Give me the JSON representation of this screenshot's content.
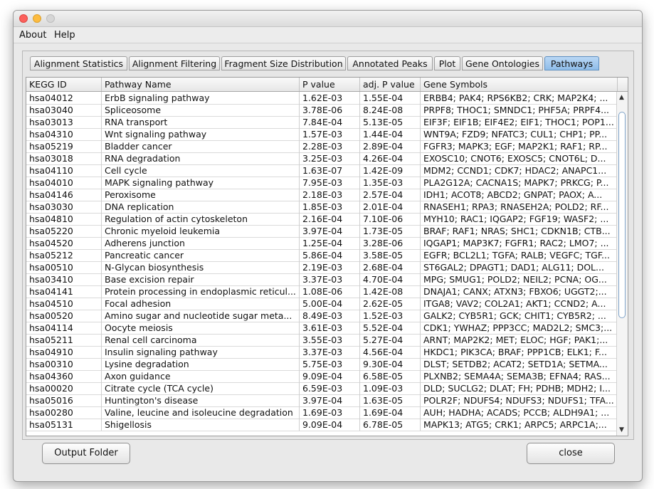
{
  "menubar": {
    "items": [
      "About",
      "Help"
    ]
  },
  "tabs": [
    {
      "label": "Alignment Statistics"
    },
    {
      "label": "Alignment Filtering"
    },
    {
      "label": "Fragment Size Distribution"
    },
    {
      "label": "Annotated Peaks"
    },
    {
      "label": "Plot"
    },
    {
      "label": "Gene Ontologies"
    },
    {
      "label": "Pathways"
    }
  ],
  "table": {
    "columns": [
      "KEGG ID",
      "Pathway Name",
      "P value",
      "adj. P value",
      "Gene Symbols"
    ],
    "rows": [
      [
        "hsa04012",
        "ErbB signaling pathway",
        "1.62E-03",
        "1.55E-04",
        "ERBB4; PAK4; RPS6KB2; CRK; MAP2K4; ..."
      ],
      [
        "hsa03040",
        "Spliceosome",
        "3.78E-06",
        "8.24E-08",
        "PRPF8; THOC1; SMNDC1; PHF5A; PRPF4..."
      ],
      [
        "hsa03013",
        "RNA transport",
        "7.84E-04",
        "5.13E-05",
        "EIF3F; EIF1B; EIF4E2; EIF1; THOC1; POP1..."
      ],
      [
        "hsa04310",
        "Wnt signaling pathway",
        "1.57E-03",
        "1.44E-04",
        "WNT9A; FZD9; NFATC3; CUL1; CHP1; PP..."
      ],
      [
        "hsa05219",
        "Bladder cancer",
        "2.28E-03",
        "2.89E-04",
        "FGFR3; MAPK3; EGF; MAP2K1; RAF1; RP..."
      ],
      [
        "hsa03018",
        "RNA degradation",
        "3.25E-03",
        "4.26E-04",
        "EXOSC10; CNOT6; EXOSC5; CNOT6L; D..."
      ],
      [
        "hsa04110",
        "Cell cycle",
        "1.63E-07",
        "1.42E-09",
        "MDM2; CCND1; CDK7; HDAC2; ANAPC1..."
      ],
      [
        "hsa04010",
        "MAPK signaling pathway",
        "7.95E-03",
        "1.35E-03",
        "PLA2G12A; CACNA1S; MAPK7; PRKCG; P..."
      ],
      [
        "hsa04146",
        "Peroxisome",
        "2.18E-03",
        "2.57E-04",
        "IDH1; ACOT8; ABCD2; GNPAT; PAOX; A..."
      ],
      [
        "hsa03030",
        "DNA replication",
        "1.85E-03",
        "2.01E-04",
        "RNASEH1; RPA3; RNASEH2A; POLD2; RF..."
      ],
      [
        "hsa04810",
        "Regulation of actin cytoskeleton",
        "2.16E-04",
        "7.10E-06",
        "MYH10; RAC1; IQGAP2; FGF19; WASF2; ..."
      ],
      [
        "hsa05220",
        "Chronic myeloid leukemia",
        "3.97E-04",
        "1.73E-05",
        "BRAF; RAF1; NRAS; SHC1; CDKN1B; CTB..."
      ],
      [
        "hsa04520",
        "Adherens junction",
        "1.25E-04",
        "3.28E-06",
        "IQGAP1; MAP3K7; FGFR1; RAC2; LMO7; ..."
      ],
      [
        "hsa05212",
        "Pancreatic cancer",
        "5.86E-04",
        "3.58E-05",
        "EGFR; BCL2L1; TGFA; RALB; VEGFC; TGF..."
      ],
      [
        "hsa00510",
        "N-Glycan biosynthesis",
        "2.19E-03",
        "2.68E-04",
        "ST6GAL2; DPAGT1; DAD1; ALG11; DOL..."
      ],
      [
        "hsa03410",
        "Base excision repair",
        "3.37E-03",
        "4.70E-04",
        "MPG; SMUG1; POLD2; NEIL2; PCNA; OG..."
      ],
      [
        "hsa04141",
        "Protein processing in endoplasmic reticul...",
        "1.08E-06",
        "1.42E-08",
        "DNAJA1; CANX; ATXN3; FBXO6; UGGT2;..."
      ],
      [
        "hsa04510",
        "Focal adhesion",
        "5.00E-04",
        "2.62E-05",
        "ITGA8; VAV2; COL2A1; AKT1; CCND2; A..."
      ],
      [
        "hsa00520",
        "Amino sugar and nucleotide sugar meta...",
        "8.49E-03",
        "1.52E-03",
        "GALK2; CYB5R1; GCK; CHIT1; CYB5R2; ..."
      ],
      [
        "hsa04114",
        "Oocyte meiosis",
        "3.61E-03",
        "5.52E-04",
        "CDK1; YWHAZ; PPP3CC; MAD2L2; SMC3;..."
      ],
      [
        "hsa05211",
        "Renal cell carcinoma",
        "3.55E-03",
        "5.27E-04",
        "ARNT; MAP2K2; MET; ELOC; HGF; PAK1;..."
      ],
      [
        "hsa04910",
        "Insulin signaling pathway",
        "3.37E-03",
        "4.56E-04",
        "HKDC1; PIK3CA; BRAF; PPP1CB; ELK1; F..."
      ],
      [
        "hsa00310",
        "Lysine degradation",
        "5.75E-03",
        "9.30E-04",
        "DLST; SETDB2; ACAT2; SETD1A; SETMA..."
      ],
      [
        "hsa04360",
        "Axon guidance",
        "9.09E-04",
        "6.58E-05",
        "PLXNB2; SEMA4A; SEMA3B; EFNA4; RAS..."
      ],
      [
        "hsa00020",
        "Citrate cycle (TCA cycle)",
        "6.59E-03",
        "1.09E-03",
        "DLD; SUCLG2; DLAT; FH; PDHB; MDH2; I..."
      ],
      [
        "hsa05016",
        "Huntington's disease",
        "3.97E-04",
        "1.63E-05",
        "POLR2F; NDUFS4; NDUFS3; NDUFS1; TFA..."
      ],
      [
        "hsa00280",
        "Valine, leucine and isoleucine degradation",
        "1.69E-03",
        "1.69E-04",
        "AUH; HADHA; ACADS; PCCB; ALDH9A1; ..."
      ],
      [
        "hsa05131",
        "Shigellosis",
        "9.09E-04",
        "6.78E-05",
        "MAPK13; ATG5; CRK1; ARPC5; ARPC1A;..."
      ]
    ]
  },
  "buttons": {
    "output_folder": "Output Folder",
    "close": "close"
  },
  "scrollbar": {
    "up_icon": "▲",
    "down_icon": "▼"
  },
  "colors": {
    "active_tab": "#9cc6ef",
    "window_bg": "#e9e9e9"
  }
}
